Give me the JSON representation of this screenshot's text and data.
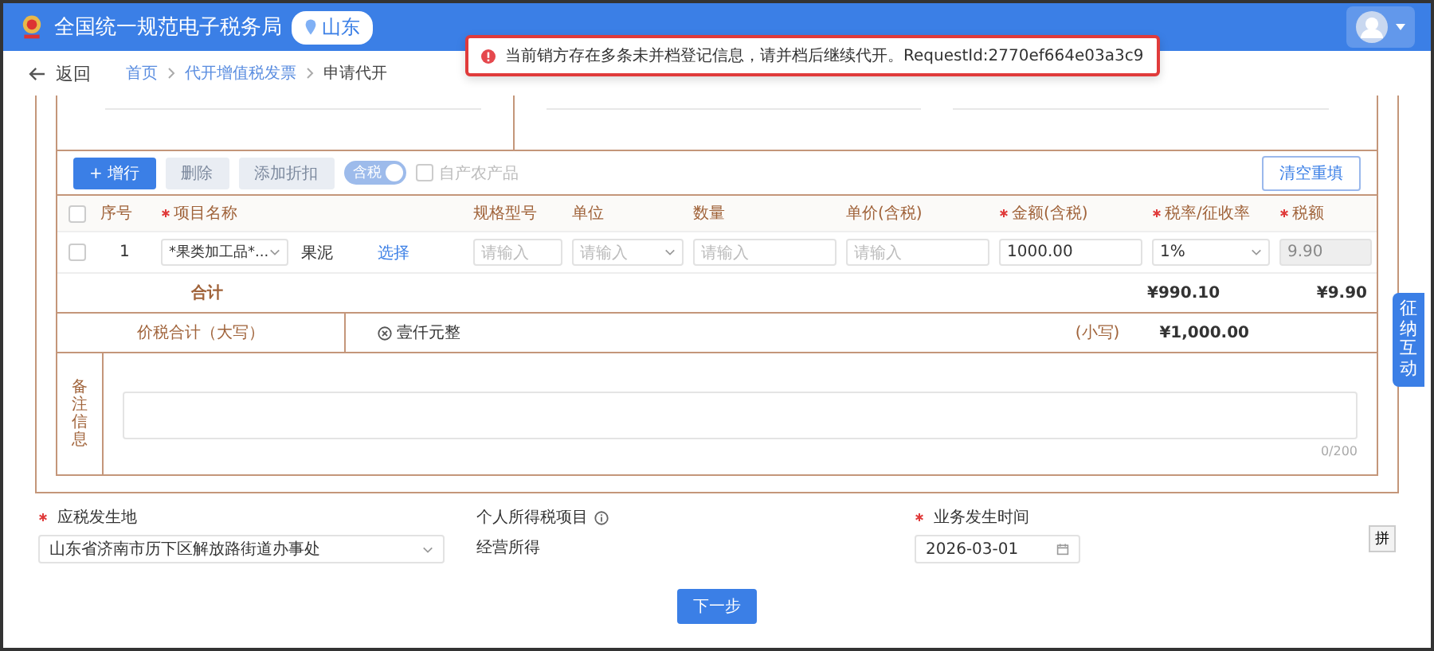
{
  "header": {
    "title": "全国统一规范电子税务局",
    "region": "山东"
  },
  "toast": {
    "message": "当前销方存在多条未并档登记信息，请并档后继续代开。RequestId:2770ef664e03a3c9"
  },
  "nav": {
    "back": "返回",
    "breadcrumb": [
      {
        "label": "首页",
        "current": false
      },
      {
        "label": "代开增值税发票",
        "current": false
      },
      {
        "label": "申请代开",
        "current": true
      }
    ]
  },
  "toolbar": {
    "buttons": [
      {
        "label": "+ 增行",
        "disabled": false
      },
      {
        "label": "删除",
        "disabled": true
      },
      {
        "label": "添加折扣",
        "disabled": true
      }
    ],
    "toggle": {
      "label": "含税",
      "on": true
    },
    "checkbox": {
      "label": "自产农产品",
      "checked": false
    },
    "clear_button": "清空重填"
  },
  "table": {
    "columns": [
      {
        "kind": "checkbox",
        "checked": false
      },
      {
        "kind": "text",
        "label": "序号",
        "required": false
      },
      {
        "kind": "text",
        "label": "项目名称",
        "required": true
      },
      {
        "kind": "text",
        "label": "规格型号",
        "required": false
      },
      {
        "kind": "text",
        "label": "单位",
        "required": false
      },
      {
        "kind": "text",
        "label": "数量",
        "required": false
      },
      {
        "kind": "text",
        "label": "单价(含税)",
        "required": false
      },
      {
        "kind": "text",
        "label": "金额(含税)",
        "required": true
      },
      {
        "kind": "text",
        "label": "税率/征收率",
        "required": true
      },
      {
        "kind": "text",
        "label": "税额",
        "required": true
      }
    ],
    "rows": [
      {
        "cells": [
          {
            "kind": "checkbox",
            "checked": false
          },
          {
            "kind": "text",
            "text": "1"
          },
          {
            "kind": "item",
            "select": "*果类加工品*...",
            "value": "果泥",
            "link": "选择"
          },
          {
            "kind": "input",
            "placeholder": "请输入",
            "disabled": false
          },
          {
            "kind": "select",
            "placeholder": "请输入"
          },
          {
            "kind": "input",
            "placeholder": "请输入",
            "disabled": false
          },
          {
            "kind": "input",
            "placeholder": "请输入",
            "disabled": false
          },
          {
            "kind": "input",
            "value": "1000.00",
            "disabled": false
          },
          {
            "kind": "select",
            "value": "1%"
          },
          {
            "kind": "input",
            "value": "9.90",
            "disabled": true
          }
        ]
      }
    ],
    "total": {
      "label": "合计",
      "amount": "¥990.10",
      "tax": "¥9.90"
    }
  },
  "grand_total": {
    "label": "价税合计（大写）",
    "words": "壹仟元整",
    "small_label": "(小写)",
    "amount": "¥1,000.00"
  },
  "remarks": {
    "label": "备注信息",
    "counter": "0/200"
  },
  "fields": [
    {
      "kind": "select",
      "label": "应税发生地",
      "required": true,
      "info": false,
      "value": "山东省济南市历下区解放路街道办事处"
    },
    {
      "kind": "text",
      "label": "个人所得税项目",
      "required": false,
      "info": true,
      "value": "经营所得"
    },
    {
      "kind": "date",
      "label": "业务发生时间",
      "required": true,
      "info": false,
      "value": "2026-03-01"
    }
  ],
  "next_button": "下一步",
  "side_tab": "征纳互动",
  "pin_button": "拼"
}
